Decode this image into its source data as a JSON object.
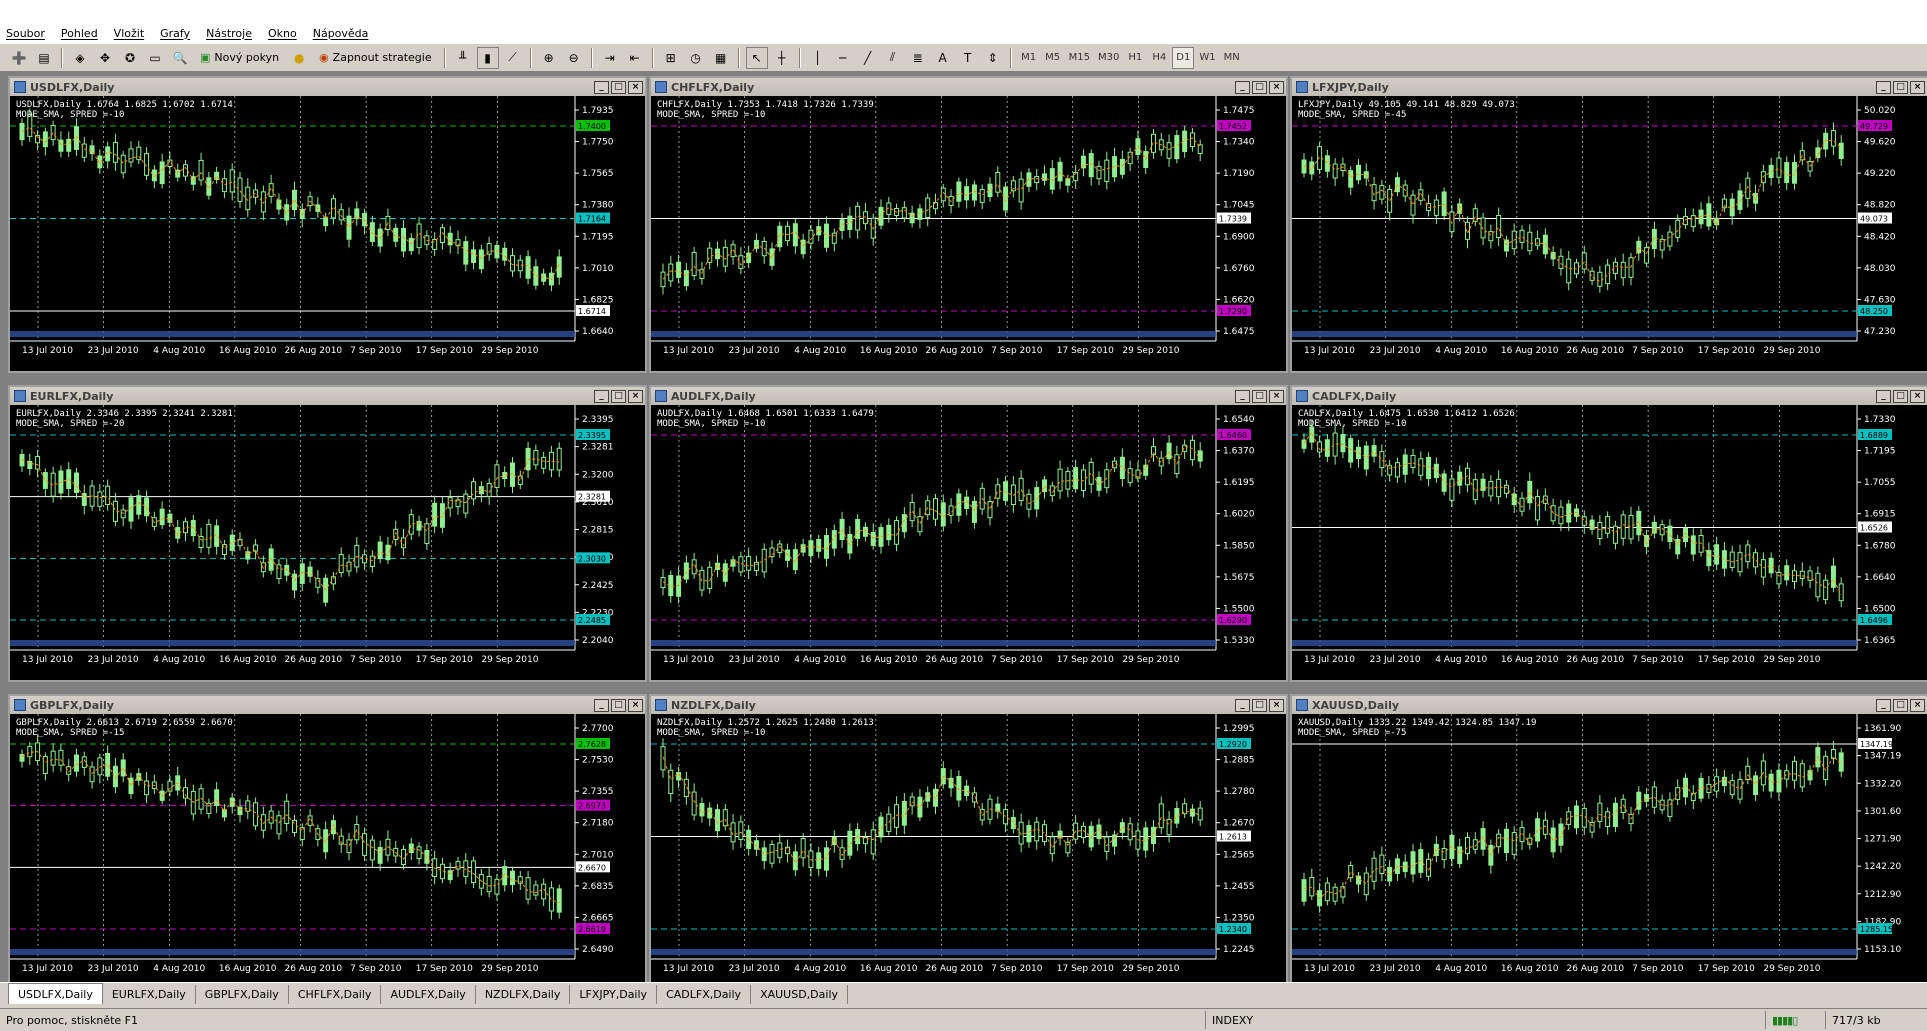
{
  "menu": [
    "Soubor",
    "Pohled",
    "Vložit",
    "Grafy",
    "Nástroje",
    "Okno",
    "Nápověda"
  ],
  "toolbar": {
    "new_order": "Nový pokyn",
    "strategy": "Zapnout strategie",
    "timeframes": [
      "M1",
      "M5",
      "M15",
      "M30",
      "H1",
      "H4",
      "D1",
      "W1",
      "MN"
    ],
    "active_timeframe": "D1"
  },
  "charts": [
    {
      "title": "USDLFX,Daily",
      "info1": "USDLFX,Daily  1.6764 1.6825 1.6702 1.6714",
      "info2": "MODE_SMA, SPRED =-10",
      "prices": [
        "1.7935",
        "1.7750",
        "1.7565",
        "1.7380",
        "1.7195",
        "1.7010",
        "1.6825",
        "1.6640"
      ],
      "markers": [
        {
          "label": "1.7400",
          "color": "#00c000"
        },
        {
          "label": "1.7164",
          "color": "#00c0c0"
        },
        {
          "label": "1.6714",
          "color": "#ffffff"
        }
      ],
      "trend": "down"
    },
    {
      "title": "CHFLFX,Daily",
      "info1": "CHFLFX,Daily  1.7353 1.7418 1.7326 1.7339",
      "info2": "MODE_SMA, SPRED =-10",
      "prices": [
        "1.7475",
        "1.7340",
        "1.7190",
        "1.7045",
        "1.6900",
        "1.6760",
        "1.6620",
        "1.6475"
      ],
      "markers": [
        {
          "label": "1.7452",
          "color": "#c000c0"
        },
        {
          "label": "1.7339",
          "color": "#ffffff"
        },
        {
          "label": "1.7290",
          "color": "#c000c0"
        }
      ],
      "trend": "up"
    },
    {
      "title": "LFXJPY,Daily",
      "info1": "LFXJPY,Daily  49.105 49.141 48.829 49.073",
      "info2": "MODE_SMA, SPRED =-45",
      "prices": [
        "50.020",
        "49.620",
        "49.220",
        "48.820",
        "48.420",
        "48.030",
        "47.630",
        "47.230"
      ],
      "markers": [
        {
          "label": "49.729",
          "color": "#c000c0"
        },
        {
          "label": "49.073",
          "color": "#ffffff"
        },
        {
          "label": "48.250",
          "color": "#00c0c0"
        }
      ],
      "trend": "vshape"
    },
    {
      "title": "EURLFX,Daily",
      "info1": "EURLFX,Daily  2.3346 2.3395 2.3241 2.3281",
      "info2": "MODE_SMA, SPRED =-20",
      "prices": [
        "2.3395",
        "2.3281",
        "2.3200",
        "2.3010",
        "2.2815",
        "2.2620",
        "2.2425",
        "2.2230",
        "2.2040"
      ],
      "markers": [
        {
          "label": "2.3395",
          "color": "#00c0c0"
        },
        {
          "label": "2.3281",
          "color": "#ffffff"
        },
        {
          "label": "2.3030",
          "color": "#00c0c0"
        },
        {
          "label": "2.2485",
          "color": "#00c0c0"
        }
      ],
      "trend": "vshape"
    },
    {
      "title": "AUDLFX,Daily",
      "info1": "AUDLFX,Daily  1.6468 1.6501 1.6333 1.6479",
      "info2": "MODE_SMA, SPRED =-10",
      "prices": [
        "1.6540",
        "1.6370",
        "1.6195",
        "1.6020",
        "1.5850",
        "1.5675",
        "1.5500",
        "1.5330"
      ],
      "markers": [
        {
          "label": "1.6460",
          "color": "#c000c0"
        },
        {
          "label": "1.6290",
          "color": "#c000c0"
        }
      ],
      "trend": "up"
    },
    {
      "title": "CADLFX,Daily",
      "info1": "CADLFX,Daily  1.6475 1.6530 1.6412 1.6526",
      "info2": "MODE_SMA, SPRED =-10",
      "prices": [
        "1.7330",
        "1.7195",
        "1.7055",
        "1.6915",
        "1.6780",
        "1.6640",
        "1.6500",
        "1.6365"
      ],
      "markers": [
        {
          "label": "1.6889",
          "color": "#00c0c0"
        },
        {
          "label": "1.6526",
          "color": "#ffffff"
        },
        {
          "label": "1.6496",
          "color": "#00c0c0"
        }
      ],
      "trend": "down"
    },
    {
      "title": "GBPLFX,Daily",
      "info1": "GBPLFX,Daily  2.6613 2.6719 2.6559 2.6670",
      "info2": "MODE_SMA, SPRED =-15",
      "prices": [
        "2.7700",
        "2.7530",
        "2.7355",
        "2.7180",
        "2.7010",
        "2.6835",
        "2.6665",
        "2.6490"
      ],
      "markers": [
        {
          "label": "2.7628",
          "color": "#00c000"
        },
        {
          "label": "2.6973",
          "color": "#c000c0"
        },
        {
          "label": "2.6670",
          "color": "#ffffff"
        },
        {
          "label": "2.6619",
          "color": "#c000c0"
        }
      ],
      "trend": "down"
    },
    {
      "title": "NZDLFX,Daily",
      "info1": "NZDLFX,Daily  1.2572 1.2625 1.2480 1.2613",
      "info2": "MODE_SMA, SPRED =-10",
      "prices": [
        "1.2995",
        "1.2885",
        "1.2780",
        "1.2670",
        "1.2565",
        "1.2455",
        "1.2350",
        "1.2245"
      ],
      "markers": [
        {
          "label": "1.2920",
          "color": "#00c0c0"
        },
        {
          "label": "1.2613",
          "color": "#ffffff"
        },
        {
          "label": "1.2340",
          "color": "#00c0c0"
        }
      ],
      "trend": "triangle"
    },
    {
      "title": "XAUUSD,Daily",
      "info1": "XAUUSD,Daily  1333.22 1349.42 1324.85 1347.19",
      "info2": "MODE_SMA, SPRED =-75",
      "prices": [
        "1361.90",
        "1347.19",
        "1332.20",
        "1301.60",
        "1271.90",
        "1242.20",
        "1212.90",
        "1182.90",
        "1153.10"
      ],
      "markers": [
        {
          "label": "1347.19",
          "color": "#ffffff"
        },
        {
          "label": "1285.15",
          "color": "#00c0c0"
        }
      ],
      "trend": "up"
    }
  ],
  "dates": [
    "13 Jul 2010",
    "23 Jul 2010",
    "4 Aug 2010",
    "16 Aug 2010",
    "26 Aug 2010",
    "7 Sep 2010",
    "17 Sep 2010",
    "29 Sep 2010"
  ],
  "tabs": [
    "USDLFX,Daily",
    "EURLFX,Daily",
    "GBPLFX,Daily",
    "CHFLFX,Daily",
    "AUDLFX,Daily",
    "NZDLFX,Daily",
    "LFXJPY,Daily",
    "CADLFX,Daily",
    "XAUUSD,Daily"
  ],
  "active_tab": "USDLFX,Daily",
  "status": {
    "help": "Pro pomoc, stiskněte F1",
    "profile": "INDEXY",
    "traffic": "717/3 kb"
  },
  "colors": {
    "candle": "#90ee90",
    "axis": "#ffffff",
    "grid": "#ffffff",
    "ma": "#ff8c00"
  }
}
